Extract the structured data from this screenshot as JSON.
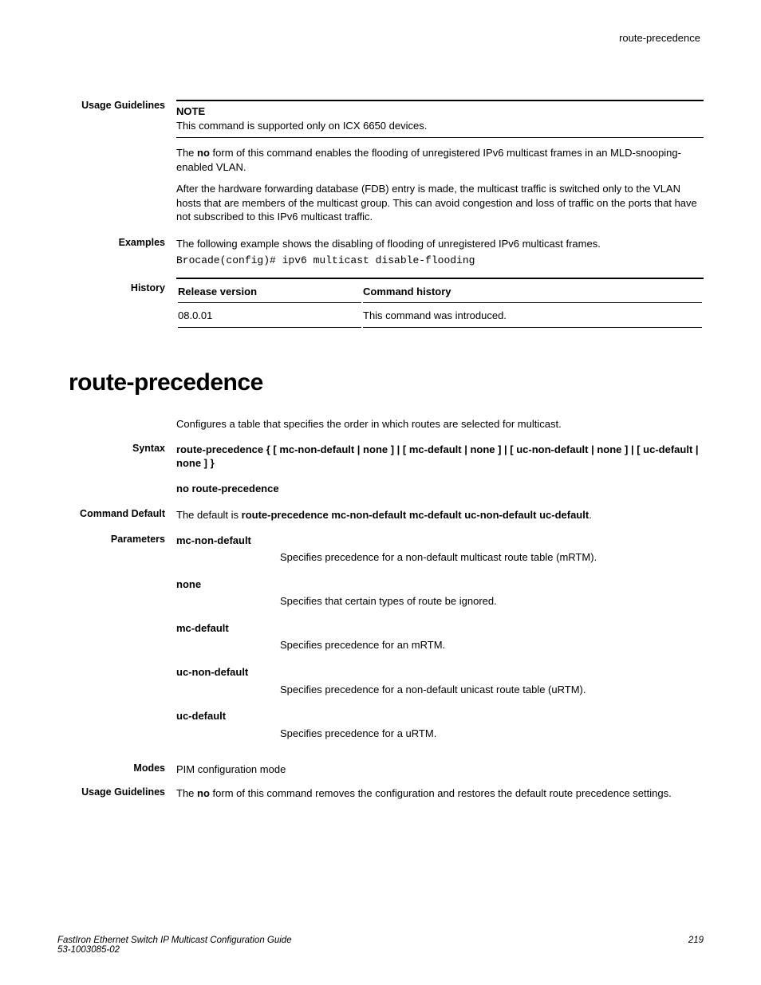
{
  "header": {
    "running": "route-precedence"
  },
  "sec1": {
    "label_usage": "Usage Guidelines",
    "note_title": "NOTE",
    "note_text": "This command is supported only on ICX 6650 devices.",
    "p1_a": "The ",
    "p1_b": "no",
    "p1_c": " form of this command enables the flooding of unregistered IPv6 multicast frames in an MLD-snooping-enabled VLAN.",
    "p2": "After the hardware forwarding database (FDB) entry is made, the multicast traffic is switched only to the VLAN hosts that are members of the multicast group. This can avoid congestion and loss of traffic on the ports that have not subscribed to this IPv6 multicast traffic.",
    "label_examples": "Examples",
    "ex_intro": "The following example shows the disabling of flooding of unregistered IPv6 multicast frames.",
    "ex_code": "Brocade(config)# ipv6 multicast disable-flooding",
    "label_history": "History",
    "hist_h1": "Release version",
    "hist_h2": "Command history",
    "hist_r1c1": "08.0.01",
    "hist_r1c2": "This command was introduced."
  },
  "sec2": {
    "title": "route-precedence",
    "desc": "Configures a table that specifies the order in which routes are selected for multicast.",
    "label_syntax": "Syntax",
    "syntax_line": "route-precedence { [ mc-non-default | none ] | [ mc-default | none ] | [ uc-non-default | none ] | [ uc-default | none ] }",
    "syntax_no": "no route-precedence",
    "label_default": "Command Default",
    "default_a": "The default is ",
    "default_b": "route-precedence mc-non-default mc-default uc-non-default uc-default",
    "default_c": ".",
    "label_params": "Parameters",
    "params": [
      {
        "term": "mc-non-default",
        "desc": "Specifies precedence for a non-default multicast route table (mRTM)."
      },
      {
        "term": "none",
        "desc": "Specifies that certain types of route be ignored."
      },
      {
        "term": "mc-default",
        "desc": "Specifies precedence for an mRTM."
      },
      {
        "term": "uc-non-default",
        "desc": "Specifies precedence for a non-default unicast route table (uRTM)."
      },
      {
        "term": "uc-default",
        "desc": "Specifies precedence for a uRTM."
      }
    ],
    "label_modes": "Modes",
    "modes_text": "PIM configuration mode",
    "label_usage": "Usage Guidelines",
    "usage_a": "The ",
    "usage_b": "no",
    "usage_c": " form of this command removes the configuration and restores the default route precedence settings."
  },
  "footer": {
    "line1": "FastIron Ethernet Switch IP Multicast Configuration Guide",
    "line2": "53-1003085-02",
    "page": "219"
  }
}
